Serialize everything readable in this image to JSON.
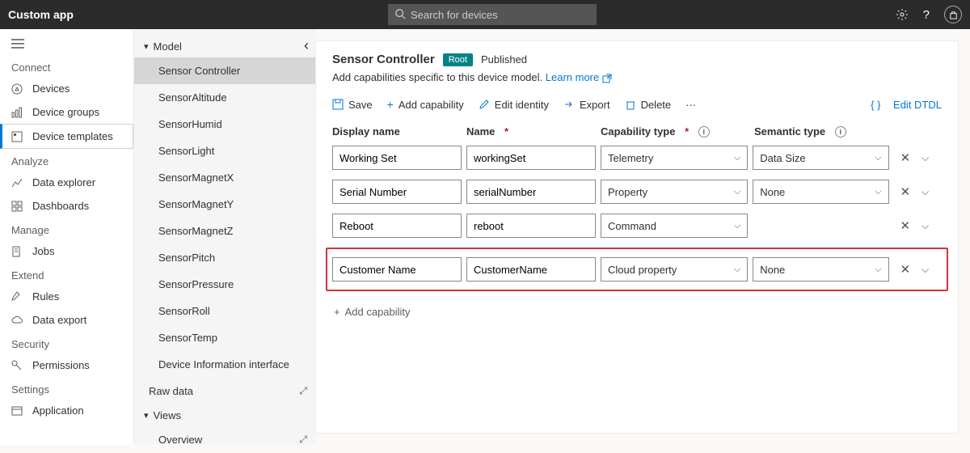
{
  "app": {
    "title": "Custom app"
  },
  "search": {
    "placeholder": "Search for devices"
  },
  "nav": {
    "connect": "Connect",
    "devices": "Devices",
    "device_groups": "Device groups",
    "device_templates": "Device templates",
    "analyze": "Analyze",
    "data_explorer": "Data explorer",
    "dashboards": "Dashboards",
    "manage": "Manage",
    "jobs": "Jobs",
    "extend": "Extend",
    "rules": "Rules",
    "data_export": "Data export",
    "security": "Security",
    "permissions": "Permissions",
    "settings": "Settings",
    "application": "Application"
  },
  "model": {
    "header": "Model",
    "items": [
      "Sensor Controller",
      "SensorAltitude",
      "SensorHumid",
      "SensorLight",
      "SensorMagnetX",
      "SensorMagnetY",
      "SensorMagnetZ",
      "SensorPitch",
      "SensorPressure",
      "SensorRoll",
      "SensorTemp",
      "Device Information interface"
    ],
    "raw_data": "Raw data",
    "views": "Views",
    "overview": "Overview"
  },
  "main": {
    "title": "Sensor Controller",
    "root": "Root",
    "status": "Published",
    "subtitle": "Add capabilities specific to this device model.",
    "learn_more": "Learn more",
    "toolbar": {
      "save": "Save",
      "add_capability": "Add capability",
      "edit_identity": "Edit identity",
      "export": "Export",
      "delete": "Delete",
      "edit_dtdl": "Edit DTDL"
    },
    "headers": {
      "display_name": "Display name",
      "name": "Name",
      "capability_type": "Capability type",
      "semantic_type": "Semantic type"
    },
    "rows": [
      {
        "display": "Working Set",
        "name": "workingSet",
        "cap": "Telemetry",
        "sem": "Data Size",
        "sem_box": true
      },
      {
        "display": "Serial Number",
        "name": "serialNumber",
        "cap": "Property",
        "sem": "None",
        "sem_box": true
      },
      {
        "display": "Reboot",
        "name": "reboot",
        "cap": "Command",
        "sem": "",
        "sem_box": false
      },
      {
        "display": "Customer Name",
        "name": "CustomerName",
        "cap": "Cloud property",
        "sem": "None",
        "sem_box": true,
        "highlight": true
      }
    ],
    "add_row": "Add capability"
  }
}
